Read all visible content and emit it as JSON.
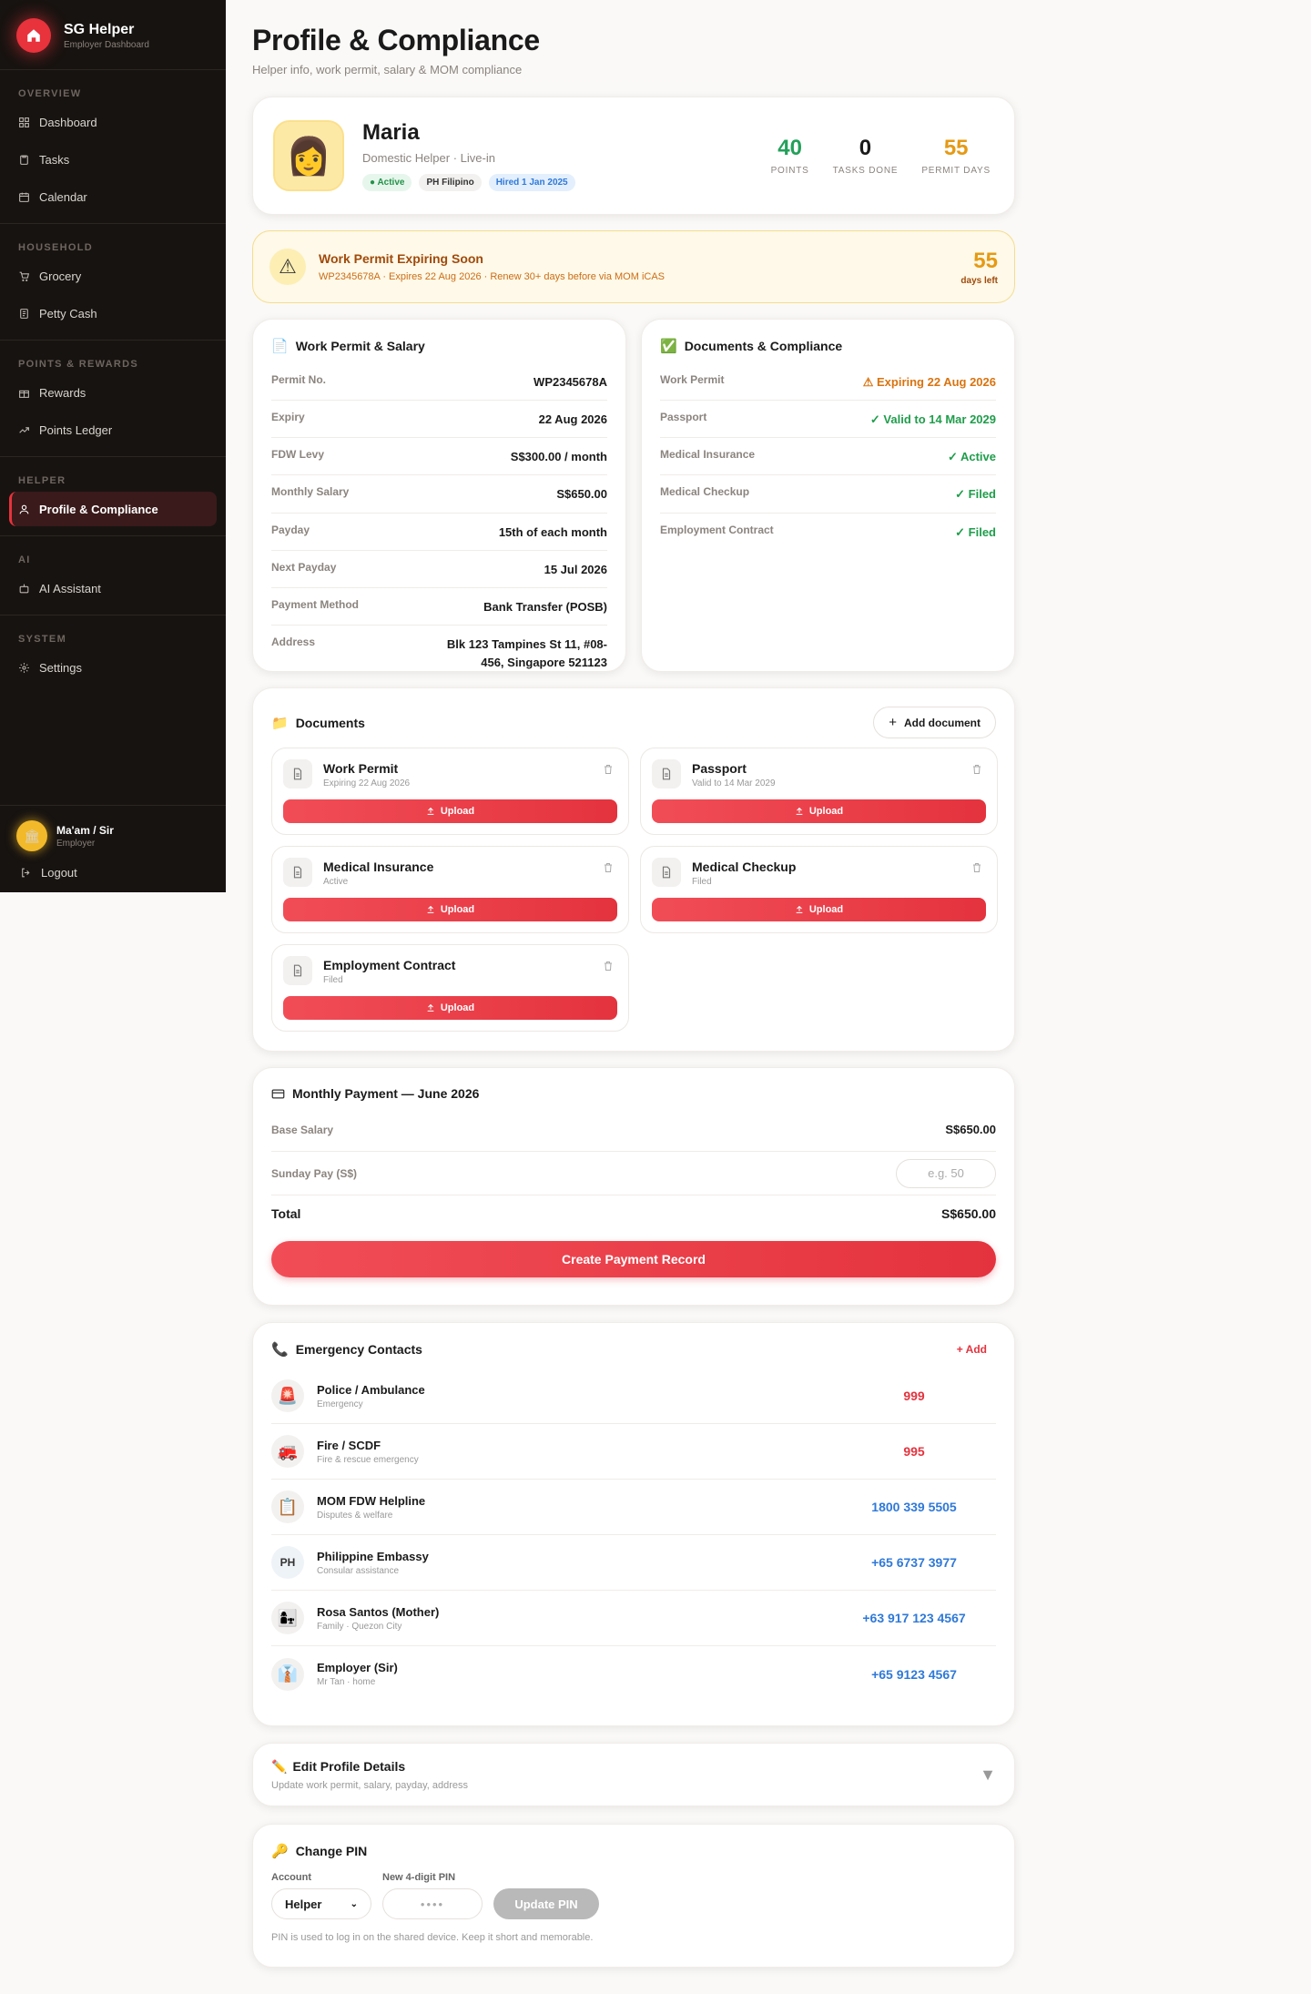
{
  "sidebar": {
    "brand_title": "SG Helper",
    "brand_sub": "Employer Dashboard",
    "sections": [
      {
        "label": "OVERVIEW",
        "items": [
          "Dashboard",
          "Tasks",
          "Calendar"
        ]
      },
      {
        "label": "HOUSEHOLD",
        "items": [
          "Grocery",
          "Petty Cash"
        ]
      },
      {
        "label": "POINTS & REWARDS",
        "items": [
          "Rewards",
          "Points Ledger"
        ]
      },
      {
        "label": "HELPER",
        "items": [
          "Profile & Compliance"
        ]
      },
      {
        "label": "AI",
        "items": [
          "AI Assistant"
        ]
      },
      {
        "label": "SYSTEM",
        "items": [
          "Settings"
        ]
      }
    ],
    "user_name": "Ma'am / Sir",
    "user_role": "Employer",
    "logout": "Logout"
  },
  "page": {
    "title": "Profile & Compliance",
    "subtitle": "Helper info, work permit, salary & MOM compliance"
  },
  "profile": {
    "avatar": "👩",
    "name": "Maria",
    "role": "Domestic Helper · Live-in",
    "tag_active": "● Active",
    "tag_nationality": "PH Filipino",
    "tag_hired": "Hired 1 Jan 2025",
    "stats": [
      {
        "value": "40",
        "label": "POINTS",
        "color": "#23a05a"
      },
      {
        "value": "0",
        "label": "TASKS DONE",
        "color": "#1a1a1a"
      },
      {
        "value": "55",
        "label": "PERMIT DAYS",
        "color": "#e59a14"
      }
    ]
  },
  "alert": {
    "icon": "⚠",
    "title": "Work Permit Expiring Soon",
    "sub": "WP2345678A · Expires 22 Aug 2026 · Renew 30+ days before via MOM iCAS",
    "days": "55",
    "days_label": "days left"
  },
  "permit": {
    "title": "Work Permit & Salary",
    "rows": [
      {
        "k": "Permit No.",
        "v": "WP2345678A"
      },
      {
        "k": "Expiry",
        "v": "22 Aug 2026"
      },
      {
        "k": "FDW Levy",
        "v": "S$300.00 / month"
      },
      {
        "k": "Monthly Salary",
        "v": "S$650.00"
      },
      {
        "k": "Payday",
        "v": "15th of each month"
      },
      {
        "k": "Next Payday",
        "v": "15 Jul 2026"
      },
      {
        "k": "Payment Method",
        "v": "Bank Transfer (POSB)"
      },
      {
        "k": "Address",
        "v": "Blk 123 Tampines St 11, #08-456, Singapore 521123"
      }
    ]
  },
  "compliance": {
    "title": "Documents & Compliance",
    "rows": [
      {
        "k": "Work Permit",
        "v": "⚠ Expiring 22 Aug 2026"
      },
      {
        "k": "Passport",
        "v": "✓ Valid to 14 Mar 2029"
      },
      {
        "k": "Medical Insurance",
        "v": "✓ Active"
      },
      {
        "k": "Medical Checkup",
        "v": "✓ Filed"
      },
      {
        "k": "Employment Contract",
        "v": "✓ Filed"
      }
    ]
  },
  "documents": {
    "title": "Documents",
    "add_label": "Add document",
    "upload_label": "Upload",
    "items": [
      {
        "title": "Work Permit",
        "sub": "Expiring 22 Aug 2026"
      },
      {
        "title": "Passport",
        "sub": "Valid to 14 Mar 2029"
      },
      {
        "title": "Medical Insurance",
        "sub": "Active"
      },
      {
        "title": "Medical Checkup",
        "sub": "Filed"
      },
      {
        "title": "Employment Contract",
        "sub": "Filed"
      }
    ]
  },
  "payment": {
    "title": "Monthly Payment — June 2026",
    "base_label": "Base Salary",
    "base_value": "S$650.00",
    "sunday_label": "Sunday Pay (S$)",
    "sunday_placeholder": "e.g. 50",
    "total_label": "Total",
    "total_value": "S$650.00",
    "button": "Create Payment Record"
  },
  "emergency": {
    "title": "Emergency Contacts",
    "add_label": "+ Add",
    "items": [
      {
        "icon": "🚨",
        "name": "Police / Ambulance",
        "sub": "Emergency",
        "number": "999",
        "tone": "red"
      },
      {
        "icon": "🚒",
        "name": "Fire / SCDF",
        "sub": "Fire & rescue emergency",
        "number": "995",
        "tone": "red"
      },
      {
        "icon": "📋",
        "name": "MOM FDW Helpline",
        "sub": "Disputes & welfare",
        "number": "1800 339 5505",
        "tone": "blue"
      },
      {
        "icon": "PH",
        "name": "Philippine Embassy",
        "sub": "Consular assistance",
        "number": "+65 6737 3977",
        "tone": "blue"
      },
      {
        "icon": "👩‍👧",
        "name": "Rosa Santos (Mother)",
        "sub": "Family · Quezon City",
        "number": "+63 917 123 4567",
        "tone": "blue"
      },
      {
        "icon": "👔",
        "name": "Employer (Sir)",
        "sub": "Mr Tan · home",
        "number": "+65 9123 4567",
        "tone": "blue"
      }
    ]
  },
  "edit": {
    "title": "Edit Profile Details",
    "sub": "Update work permit, salary, payday, address"
  },
  "pin": {
    "title": "Change PIN",
    "account_label": "Account",
    "account_value": "Helper",
    "pin_label": "New 4-digit PIN",
    "pin_placeholder": "••••",
    "button": "Update PIN",
    "note": "PIN is used to log in on the shared device. Keep it short and memorable."
  }
}
